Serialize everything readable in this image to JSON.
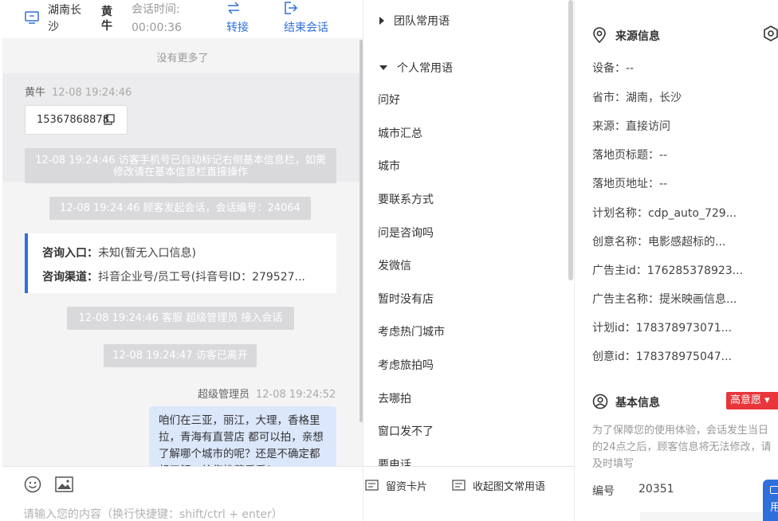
{
  "header": {
    "location": "湖南长沙",
    "visitor_name": "黄牛",
    "session_time_label": "会话时间:",
    "session_time_value": "00:00:36",
    "transfer_label": "转接",
    "end_session_label": "结束会话",
    "accent_color": "#2f6fdc"
  },
  "chat": {
    "no_more": "没有更多了",
    "visitor_message": {
      "sender": "黄牛",
      "time": "12-08 19:24:46",
      "phone": "15367868878"
    },
    "system_notice_1": "12-08 19:24:46 访客手机号已自动标记右侧基本信息栏，如需修改请在基本信息栏直接操作",
    "system_notice_2": "12-08 19:24:46 顾客发起会话，会话编号：24064",
    "entry_card": {
      "entry_label": "咨询入口：",
      "entry_value": "未知(暂无入口信息)",
      "channel_label": "咨询渠道：",
      "channel_value": "抖音企业号/员工号(抖音号ID：279527..."
    },
    "system_notice_3": "12-08 19:24:46 客服 超级管理员 接入会话",
    "system_notice_4": "12-08 19:24:47 访客已离开",
    "agent_message": {
      "sender": "超级管理员",
      "time": "12-08 19:24:52",
      "text": "咱们在三亚，丽江，大理，香格里拉，青海有直营店 都可以拍，亲想了解哪个城市的呢？还是不确定都想了解，给您推荐看看？"
    },
    "input_placeholder": "请输入您的内容（换行快捷键：shift/ctrl + enter）"
  },
  "quick_replies": {
    "team_group": "团队常用语",
    "personal_group": "个人常用语",
    "phrases": [
      "问好",
      "城市汇总",
      "城市",
      "要联系方式",
      "问是咨询吗",
      "发微信",
      "暂时没有店",
      "考虑热门城市",
      "考虑旅拍吗",
      "去哪拍",
      "窗口发不了",
      "要电话"
    ],
    "lead_card_label": "留资卡片",
    "collapse_label": "收起图文常用语"
  },
  "info_panel": {
    "source_title": "来源信息",
    "device": "设备：--",
    "province_city": "省市：湖南，长沙",
    "source": "来源：直接访问",
    "landing_title": "落地页标题：--",
    "landing_url": "落地页地址：--",
    "plan_name": "计划名称：cdp_auto_729...",
    "creative_name": "创意名称：电影感超标的...",
    "advertiser_id": "广告主id：176285378923...",
    "advertiser_name": "广告主名称：提米映画信息...",
    "plan_id": "计划id：178378973071...",
    "creative_id": "创意id：178378975047...",
    "basic_title": "基本信息",
    "intent_badge": "高意愿",
    "notice": "为了保障您的使用体验，会话发生当日的24点之后，顾客信息将无法修改，请及时填写",
    "id_label": "编号",
    "id_value": "20351",
    "float_tab_label": "用",
    "badge_color": "#e8363b"
  }
}
